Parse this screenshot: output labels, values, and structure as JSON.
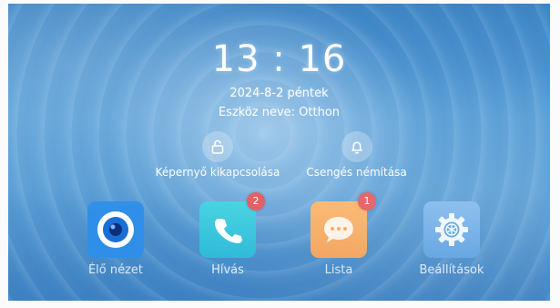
{
  "clock": {
    "time": "13 : 16",
    "date": "2024-8-2 péntek",
    "device_name": "Eszköz neve: Otthon"
  },
  "quick_actions": [
    {
      "label": "Képernyő kikapcsolása",
      "icon": "unlock-icon"
    },
    {
      "label": "Csengés némítása",
      "icon": "bell-icon"
    }
  ],
  "apps": [
    {
      "label": "Élő nézet",
      "icon": "camera-icon"
    },
    {
      "label": "Hívás",
      "icon": "phone-icon",
      "badge": "2"
    },
    {
      "label": "Lista",
      "icon": "message-icon",
      "badge": "1"
    },
    {
      "label": "Beállítások",
      "icon": "gear-icon"
    }
  ],
  "colors": {
    "badge": "#e25a5f",
    "live_tile": "#2f8fe8",
    "call_tile": "#3cc8de",
    "list_tile": "#f6a95f",
    "settings_tile": "#6aa9e6"
  }
}
